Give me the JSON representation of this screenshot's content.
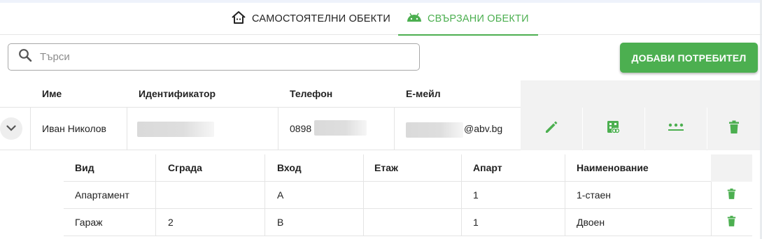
{
  "tabs": [
    {
      "label": "САМОСТОЯТЕЛНИ ОБЕКТИ",
      "icon": "house-icon",
      "active": false
    },
    {
      "label": "СВЪРЗАНИ ОБЕКТИ",
      "icon": "android-icon",
      "active": true
    }
  ],
  "search": {
    "placeholder": "Търси",
    "value": ""
  },
  "toolbar": {
    "add_user_label": "ДОБАВИ ПОТРЕБИТЕЛ"
  },
  "colors": {
    "accent": "#4caf50",
    "action_bg": "#f2f2f2"
  },
  "users_table": {
    "columns": [
      "Име",
      "Идентификатор",
      "Телефон",
      "Е-мейл"
    ],
    "rows": [
      {
        "name": "Иван Николов",
        "identifier": "",
        "phone": "0898",
        "email_suffix": "@abv.bg"
      }
    ],
    "actions": [
      "pencil-icon",
      "link-building-icon",
      "more-dots-icon",
      "trash-icon"
    ]
  },
  "objects_table": {
    "columns": [
      "Вид",
      "Сграда",
      "Вход",
      "Етаж",
      "Апарт",
      "Наименование"
    ],
    "rows": [
      [
        "Апартамент",
        "",
        "А",
        "",
        "1",
        "1-стаен"
      ],
      [
        "Гараж",
        "2",
        "В",
        "",
        "1",
        "Двоен"
      ]
    ]
  }
}
